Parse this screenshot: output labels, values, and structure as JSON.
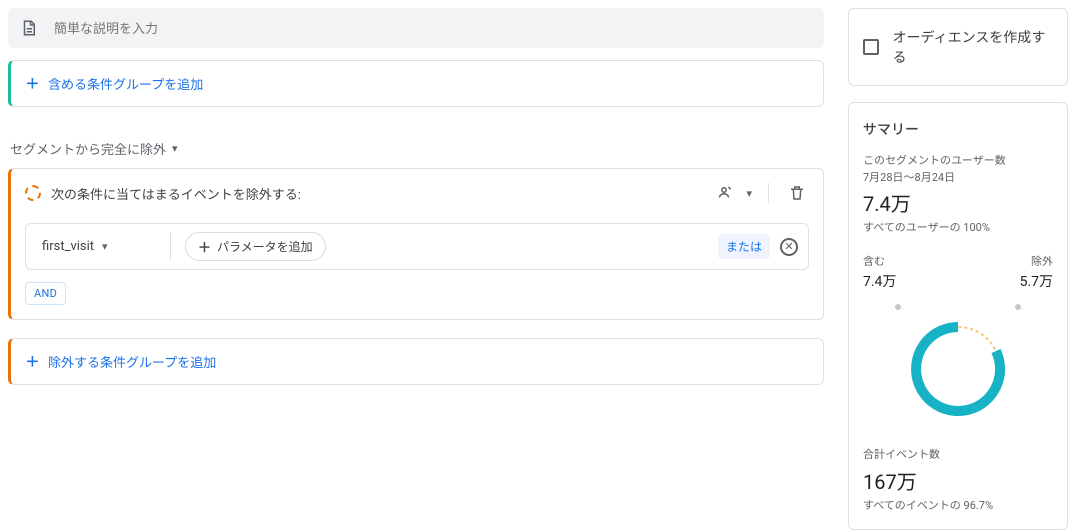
{
  "description": {
    "placeholder": "簡単な説明を入力"
  },
  "include": {
    "add_label": "含める条件グループを追加"
  },
  "exclude_section": {
    "mode_label": "セグメントから完全に除外",
    "title": "次の条件に当てはまるイベントを除外する:",
    "condition": {
      "event": "first_visit",
      "add_param_label": "パラメータを追加",
      "or_label": "または"
    },
    "and_label": "AND",
    "add_label": "除外する条件グループを追加"
  },
  "audience": {
    "create_label": "オーディエンスを作成する"
  },
  "summary": {
    "title": "サマリー",
    "users_label": "このセグメントのユーザー数",
    "date_range": "7月28日～8月24日",
    "users_value": "7.4万",
    "users_pct": "すべてのユーザーの 100%",
    "include_label": "含む",
    "include_value": "7.4万",
    "exclude_label": "除外",
    "exclude_value": "5.7万",
    "events_label": "合計イベント数",
    "events_value": "167万",
    "events_pct": "すべてのイベントの 96.7%"
  },
  "colors": {
    "accent_teal": "#1abc9c",
    "accent_orange": "#e8710a",
    "link": "#1a73e8"
  }
}
